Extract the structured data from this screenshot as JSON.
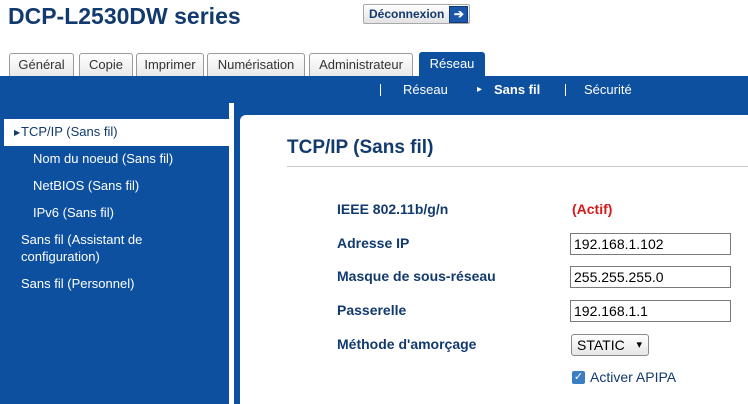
{
  "header": {
    "title": "DCP-L2530DW series",
    "logout_label": "Déconnexion",
    "logout_icon": "arrow-right-icon"
  },
  "tabs": [
    {
      "label": "Général"
    },
    {
      "label": "Copie"
    },
    {
      "label": "Imprimer"
    },
    {
      "label": "Numérisation"
    },
    {
      "label": "Administrateur"
    },
    {
      "label": "Réseau",
      "active": true
    }
  ],
  "subnav": [
    {
      "label": "Réseau"
    },
    {
      "label": "Sans fil",
      "selected": true
    },
    {
      "label": "Sécurité"
    }
  ],
  "sidebar": {
    "items": [
      {
        "label": "TCP/IP (Sans fil)",
        "selected": true
      },
      {
        "label": "Nom du noeud (Sans fil)"
      },
      {
        "label": "NetBIOS (Sans fil)"
      },
      {
        "label": "IPv6 (Sans fil)"
      },
      {
        "label": "Sans fil (Assistant de configuration)"
      },
      {
        "label": "Sans fil (Personnel)"
      }
    ]
  },
  "main": {
    "heading": "TCP/IP (Sans fil)",
    "ieee_label": "IEEE 802.11b/g/n",
    "ieee_status": "(Actif)",
    "ip_label": "Adresse IP",
    "ip_value": "192.168.1.102",
    "mask_label": "Masque de sous-réseau",
    "mask_value": "255.255.255.0",
    "gateway_label": "Passerelle",
    "gateway_value": "192.168.1.1",
    "boot_label": "Méthode d'amorçage",
    "boot_value": "STATIC",
    "apipa_label": "Activer APIPA",
    "apipa_checked": true
  },
  "colors": {
    "brand_blue": "#0d50a0",
    "title_navy": "#123a6e",
    "status_red": "#d61a1a"
  }
}
